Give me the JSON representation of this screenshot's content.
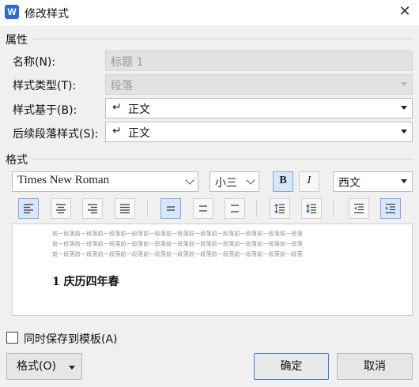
{
  "window": {
    "app_icon": "W",
    "title": "修改样式",
    "close_glyph": "✕"
  },
  "properties": {
    "section_label": "属性",
    "name_label": "名称(N):",
    "name_value": "标题 1",
    "style_type_label": "样式类型(T):",
    "style_type_value": "段落",
    "based_on_label": "样式基于(B):",
    "based_on_value": "正文",
    "next_style_label": "后续段落样式(S):",
    "next_style_value": "正文",
    "paragraph_icon": "↵"
  },
  "format": {
    "section_label": "格式",
    "font_name": "Times New Roman",
    "font_size": "小三",
    "bold_label": "B",
    "italic_label": "I",
    "script_value": "西文",
    "bold_active": true
  },
  "preview": {
    "prev_paragraph_line": "前一段落前一段落前一段落前一段落前一段落前一段落前一段落前一段落前一段落前一段落前一段落",
    "heading_text": "1 庆历四年春"
  },
  "footer": {
    "save_to_template_label": "同时保存到模板(A)",
    "format_button": "格式(O)",
    "ok_button": "确定",
    "cancel_button": "取消"
  },
  "colors": {
    "accent": "#3c7fd9",
    "active_fill": "#d7e6f8",
    "dialog_bg": "#f0f0f0"
  }
}
